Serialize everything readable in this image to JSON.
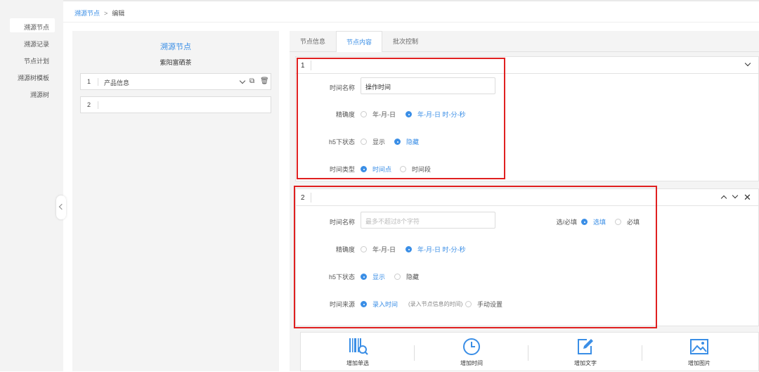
{
  "sidebar": {
    "items": [
      "溯源节点",
      "溯源记录",
      "节点计划",
      "溯源树模板",
      "溯源树"
    ]
  },
  "breadcrumb": {
    "root": "溯源节点",
    "separator": ">",
    "current": "编辑"
  },
  "left": {
    "title": "溯源节点",
    "subtitle": "紫阳富硒茶",
    "nodes": [
      {
        "num": "1",
        "label": "产品信息"
      },
      {
        "num": "2",
        "label": ""
      }
    ]
  },
  "tabs": [
    "节点信息",
    "节点内容",
    "批次控制"
  ],
  "active_tab": "节点内容",
  "card1": {
    "num": "1",
    "time_name_label": "时间名称",
    "time_name_value": "操作时间",
    "precision_label": "精确度",
    "precision_options": [
      "年-月-日",
      "年-月-日 时-分-秒"
    ],
    "h5_label": "h5下状态",
    "h5_options": [
      "显示",
      "隐藏"
    ],
    "type_label": "时间类型",
    "type_options": [
      "时间点",
      "时间段"
    ]
  },
  "card2": {
    "num": "2",
    "time_name_label": "时间名称",
    "time_name_placeholder": "最多不超过8个字符",
    "required_label": "选/必填",
    "required_options": [
      "选填",
      "必填"
    ],
    "precision_label": "精确度",
    "precision_options": [
      "年-月-日",
      "年-月-日 时-分-秒"
    ],
    "h5_label": "h5下状态",
    "h5_options": [
      "显示",
      "隐藏"
    ],
    "source_label": "时间来源",
    "source_options": [
      "录入时间",
      "手动设置"
    ],
    "source_hint": "(录入节点信息的时间)"
  },
  "toolbar": {
    "items": [
      "增加单选",
      "增加时间",
      "增加文字",
      "增加图片"
    ]
  },
  "colors": {
    "accent": "#3a8ee6",
    "highlight": "#e02020"
  }
}
